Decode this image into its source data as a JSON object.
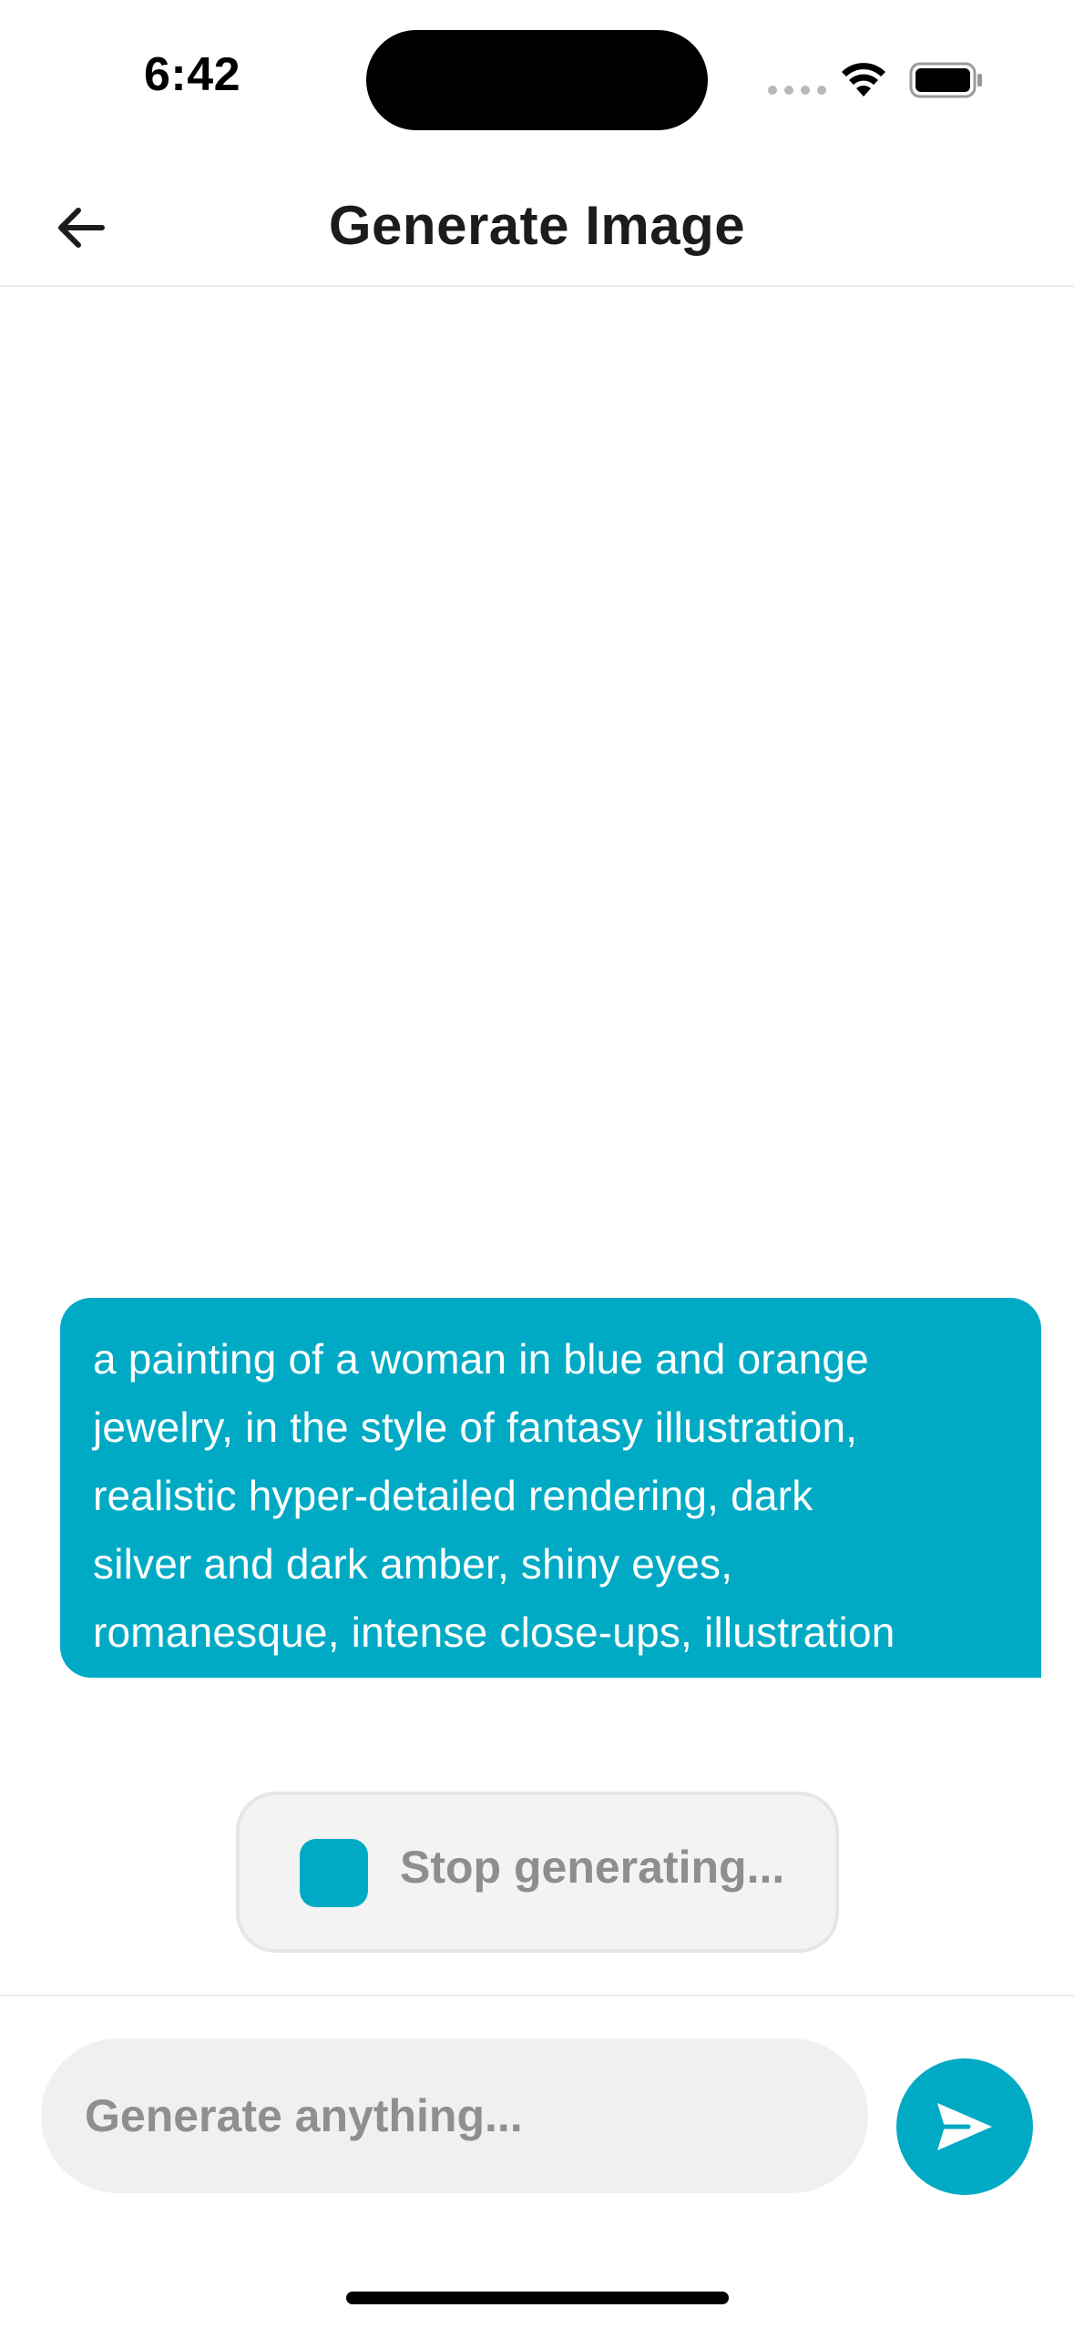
{
  "status_bar": {
    "time": "6:42"
  },
  "nav": {
    "title": "Generate Image",
    "back_icon": "arrow-left-icon"
  },
  "chat": {
    "message": {
      "lines": [
        "a painting of a woman in blue and orange",
        "jewelry, in the style of fantasy illustration,",
        "realistic hyper-detailed rendering, dark",
        "silver and dark amber, shiny eyes,",
        "romanesque, intense close-ups, illustration"
      ]
    },
    "stop_button": {
      "label": "Stop generating...",
      "icon": "stop-square-icon"
    }
  },
  "composer": {
    "placeholder": "Generate anything...",
    "value": "",
    "send_icon": "send-arrow-icon"
  },
  "colors": {
    "accent": "#00aac4",
    "bubble_text": "#ffffff",
    "muted_text": "#8e8e8e",
    "input_background": "#f0f0f0",
    "page_background": "#ffffff"
  }
}
